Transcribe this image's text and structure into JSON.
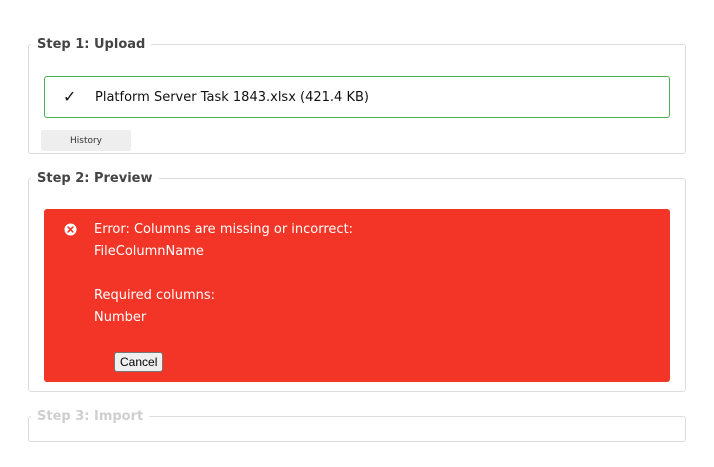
{
  "step1": {
    "title": "Step 1: Upload",
    "file_label": "Platform Server Task 1843.xlsx (421.4 KB)",
    "file_status_icon": "check-icon",
    "history_label": "History",
    "border_color": "#4caf50"
  },
  "step2": {
    "title": "Step 2: Preview",
    "error": {
      "icon": "error-circle-icon",
      "background_color": "#f23527",
      "line1": "Error: Columns are missing or incorrect:",
      "line2": "FileColumnName",
      "line3": "Required columns:",
      "line4": "Number",
      "cancel_label": "Cancel"
    }
  },
  "step3": {
    "title": "Step 3: Import"
  }
}
